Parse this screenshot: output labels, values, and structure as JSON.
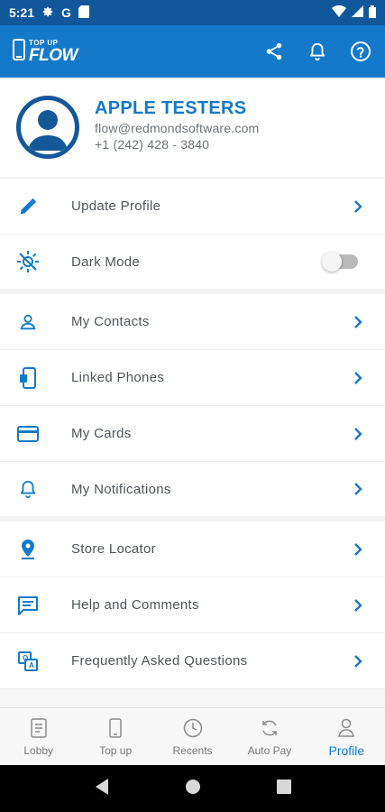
{
  "status_bar": {
    "time": "5:21",
    "left_icons": [
      "gear-icon",
      "google-icon",
      "sd-card-icon"
    ],
    "right_icons": [
      "wifi-icon",
      "signal-icon",
      "battery-icon"
    ]
  },
  "app_bar": {
    "logo_top": "TOP UP",
    "logo_main": "FLOW",
    "actions": [
      "share-icon",
      "bell-icon",
      "help-icon"
    ]
  },
  "profile": {
    "name": "APPLE TESTERS",
    "email": "flow@redmondsoftware.com",
    "phone": "+1 (242) 428 - 3840"
  },
  "menu": {
    "update_profile": "Update Profile",
    "dark_mode": "Dark Mode",
    "dark_mode_on": false,
    "my_contacts": "My Contacts",
    "linked_phones": "Linked Phones",
    "my_cards": "My Cards",
    "my_notifications": "My Notifications",
    "store_locator": "Store Locator",
    "help_comments": "Help and Comments",
    "faq": "Frequently Asked Questions"
  },
  "bottom_nav": {
    "lobby": "Lobby",
    "topup": "Top up",
    "recents": "Recents",
    "autopay": "Auto Pay",
    "profile": "Profile",
    "active": "profile"
  },
  "colors": {
    "brand": "#1479c9",
    "status_bar": "#11579c",
    "avatar_ring": "#15589a",
    "divider": "#f2f2f3"
  }
}
